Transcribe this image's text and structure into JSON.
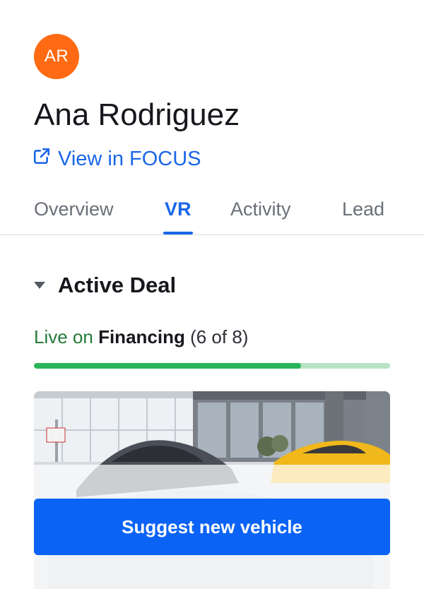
{
  "customer": {
    "initials": "AR",
    "name": "Ana Rodriguez",
    "avatar_color": "#ff6a13"
  },
  "focus_link": {
    "label": "View in FOCUS",
    "icon": "external-link-icon"
  },
  "tabs": [
    {
      "label": "Overview",
      "active": false
    },
    {
      "label": "VR",
      "active": true
    },
    {
      "label": "Activity",
      "active": false
    },
    {
      "label": "Lead",
      "active": false
    }
  ],
  "active_deal": {
    "title": "Active Deal",
    "status_prefix": "Live on",
    "stage": "Financing",
    "step_text": "(6 of 8)",
    "progress": 0.75,
    "colors": {
      "fill": "#2bb55a",
      "track": "#b8e3c4",
      "live_text": "#247a3a"
    }
  },
  "actions": {
    "suggest_label": "Suggest new vehicle"
  },
  "colors": {
    "accent": "#1a66e8",
    "button": "#0a63f5"
  }
}
